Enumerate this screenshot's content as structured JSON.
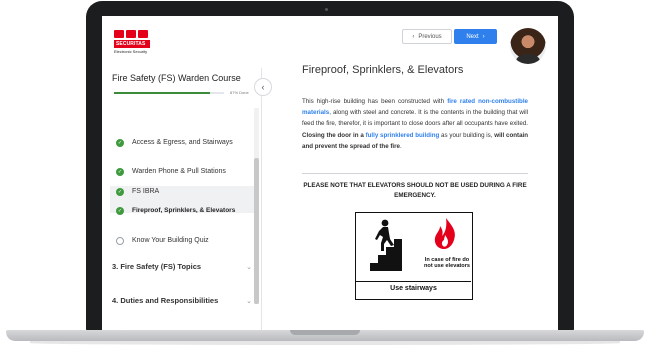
{
  "brand": {
    "name": "SECURITAS",
    "subtitle": "Electronic Security",
    "color": "#e4001b"
  },
  "nav": {
    "previous_label": "Previous",
    "previous_icon": "chevron-left-icon",
    "next_label": "Next",
    "next_icon": "chevron-right-icon",
    "next_color": "#2f80ed"
  },
  "sidebar": {
    "course_title": "Fire Safety (FS) Warden Course",
    "progress_text": "87% Done",
    "progress_value": 87,
    "collapse_icon": "chevron-left-icon",
    "lessons": [
      {
        "label": "Access & Egress, and Stairways",
        "status": "complete"
      },
      {
        "label": "Warden Phone & Pull Stations",
        "status": "complete"
      },
      {
        "label": "FS IBRA",
        "status": "complete"
      },
      {
        "label": "Fireproof, Sprinklers, & Elevators",
        "status": "complete",
        "active": true
      },
      {
        "label": "Know Your Building Quiz",
        "status": "incomplete"
      }
    ],
    "sections": [
      {
        "label": "3.  Fire Safety (FS) Topics"
      },
      {
        "label": "4.  Duties and Responsibilities"
      }
    ]
  },
  "main": {
    "title": "Fireproof, Sprinklers, & Elevators",
    "para": {
      "t1": "This high-rise building has been constructed with ",
      "link1": "fire rated non-combustible materials",
      "t2": ", along with steel and concrete. It is the contents in the building that will feed the fire, therefor, it is important to close doors after all occupants have exited. ",
      "b1": "Closing the door in a ",
      "link2": "fully sprinklered building",
      "t3": " as your building is, ",
      "b2": "will contain and prevent the spread of the fire",
      "t4": "."
    },
    "notice": "PLEASE NOTE THAT ELEVATORS SHOULD NOT BE USED DURING A FIRE EMERGENCY.",
    "sign": {
      "caption": "In case of fire do not use elevators",
      "footer": "Use stairways",
      "flame_color": "#e4001b"
    }
  }
}
